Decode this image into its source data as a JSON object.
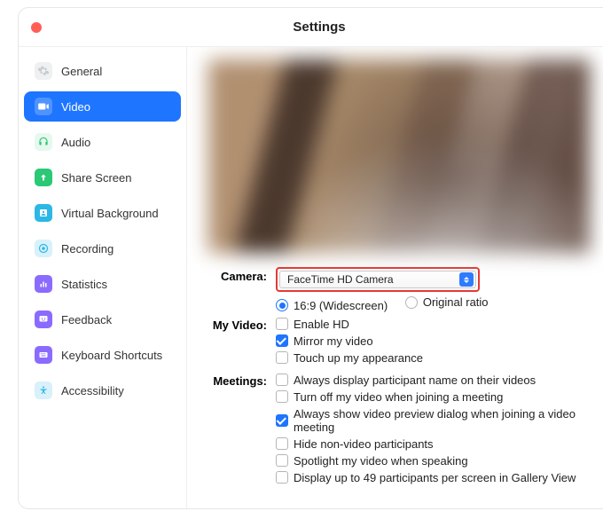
{
  "window": {
    "title": "Settings"
  },
  "sidebar": {
    "items": [
      {
        "label": "General"
      },
      {
        "label": "Video"
      },
      {
        "label": "Audio"
      },
      {
        "label": "Share Screen"
      },
      {
        "label": "Virtual Background"
      },
      {
        "label": "Recording"
      },
      {
        "label": "Statistics"
      },
      {
        "label": "Feedback"
      },
      {
        "label": "Keyboard Shortcuts"
      },
      {
        "label": "Accessibility"
      }
    ]
  },
  "form": {
    "camera_label": "Camera:",
    "camera_value": "FaceTime HD Camera",
    "ratio_wide": "16:9 (Widescreen)",
    "ratio_orig": "Original ratio",
    "myvideo_label": "My Video:",
    "enable_hd": "Enable HD",
    "mirror": "Mirror my video",
    "touchup": "Touch up my appearance",
    "meetings_label": "Meetings:",
    "m1": "Always display participant name on their videos",
    "m2": "Turn off my video when joining a meeting",
    "m3": "Always show video preview dialog when joining a video meeting",
    "m4": "Hide non-video participants",
    "m5": "Spotlight my video when speaking",
    "m6": "Display up to 49 participants per screen in Gallery View"
  }
}
